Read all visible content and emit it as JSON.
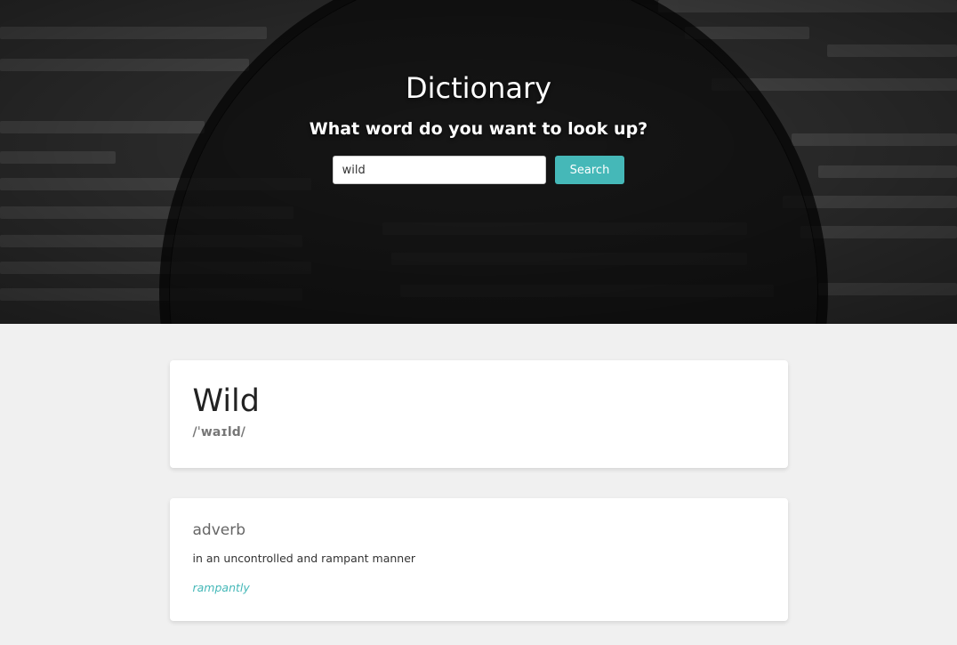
{
  "hero": {
    "title": "Dictionary",
    "subtitle": "What word do you want to look up?",
    "search": {
      "value": "wild",
      "button_label": "Search"
    }
  },
  "result": {
    "word": "Wild",
    "phonetic": "/ˈwaɪld/",
    "meanings": [
      {
        "part_of_speech": "adverb",
        "definition": "in an uncontrolled and rampant manner",
        "synonym": "rampantly"
      }
    ]
  },
  "colors": {
    "accent": "#45b8b8",
    "page_bg": "#f0f0f0",
    "hero_bg": "#2a2a2a"
  }
}
